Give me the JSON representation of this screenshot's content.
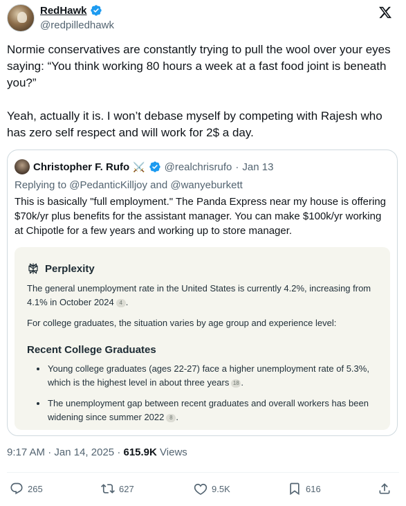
{
  "author": {
    "display_name": "RedHawk",
    "handle": "@redpilledhawk"
  },
  "tweet": {
    "paragraphs": [
      "Normie conservatives are constantly trying to pull the wool over your eyes saying: “You think working 80 hours a week at a fast food joint is beneath you?”",
      "Yeah, actually it is. I won’t debase myself by competing with Rajesh who has zero self respect and will work for 2$ a day."
    ]
  },
  "quote": {
    "display_name": "Christopher F. Rufo",
    "emoji": "⚔️",
    "handle": "@realchrisrufo",
    "separator": "·",
    "date": "Jan 13",
    "replying_prefix": "Replying to",
    "replying_to_1": "@PedanticKilljoy",
    "replying_and": "and",
    "replying_to_2": "@wanyeburkett",
    "text": "This is basically \"full employment.\" The Panda Express near my house is offering $70k/yr plus benefits for the assistant manager. You can make $100k/yr working at Chipotle for a few years and working up to store manager."
  },
  "embed": {
    "brand": "Perplexity",
    "para1": "The general unemployment rate in the United States is currently 4.2%, increasing from 4.1% in October 2024",
    "para1_cite": "4",
    "para2": "For college graduates, the situation varies by age group and experience level:",
    "heading": "Recent College Graduates",
    "items": [
      {
        "text": "Young college graduates (ages 22-27) face a higher unemployment rate of 5.3%, which is the highest level in about three years",
        "cite": "18"
      },
      {
        "text": "The unemployment gap between recent graduates and overall workers has been widening since summer 2022",
        "cite": "8"
      }
    ]
  },
  "meta": {
    "time": "9:17 AM",
    "separator": "·",
    "date": "Jan 14, 2025",
    "views_count": "615.9K",
    "views_label": "Views"
  },
  "actions": {
    "replies": "265",
    "reposts": "627",
    "likes": "9.5K",
    "bookmarks": "616"
  },
  "colors": {
    "verified": "#1d9bf0",
    "secondary_text": "#536471",
    "primary_text": "#0f1419",
    "embed_bg": "#f5f5ee"
  },
  "icons": [
    "verified-badge-icon",
    "x-logo-icon",
    "perplexity-logo-icon",
    "reply-icon",
    "retweet-icon",
    "like-icon",
    "bookmark-icon",
    "share-icon"
  ]
}
